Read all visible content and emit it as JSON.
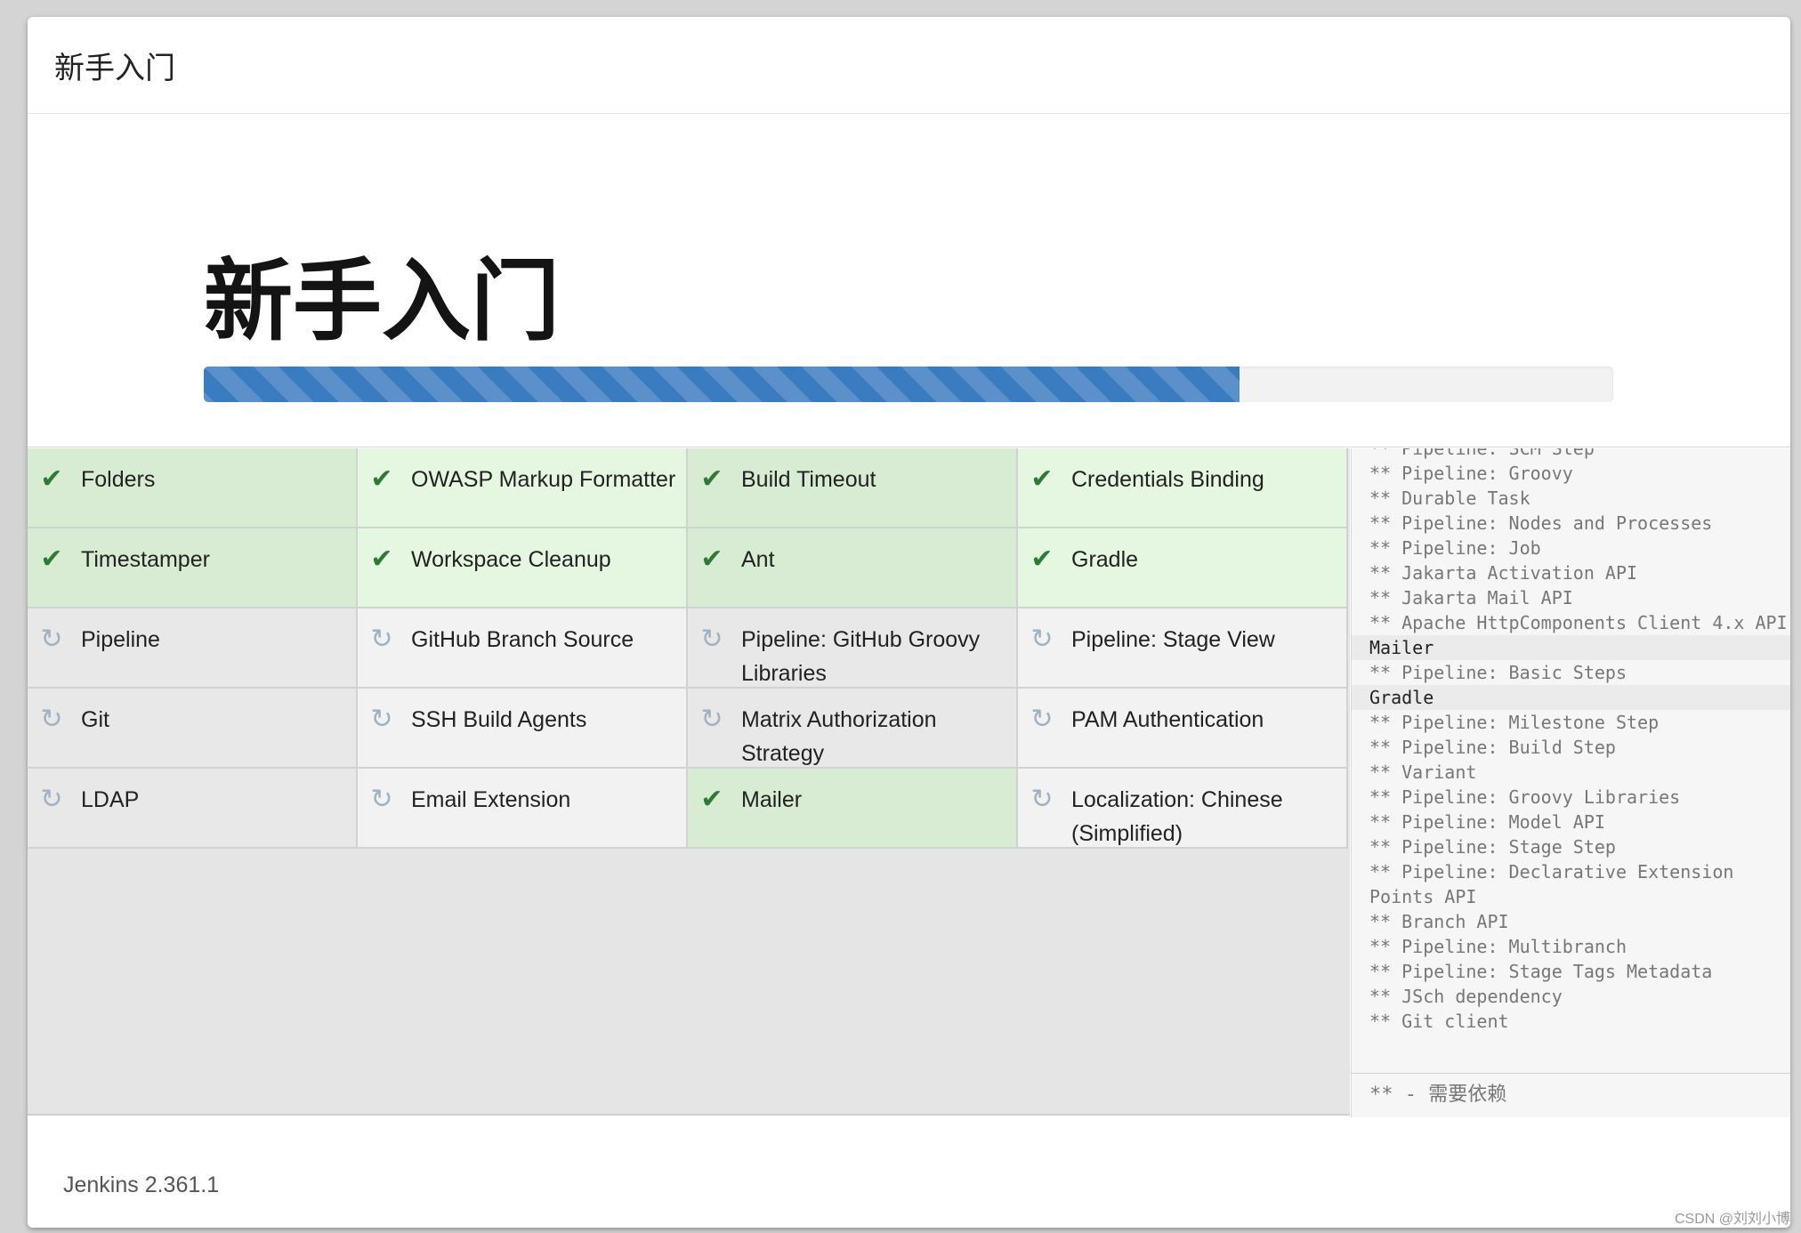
{
  "header": {
    "title": "新手入门"
  },
  "hero": {
    "title": "新手入门",
    "progress": 0.735
  },
  "plugins": [
    {
      "label": "Folders",
      "status": "success",
      "shade": "dark"
    },
    {
      "label": "OWASP Markup Formatter",
      "status": "success",
      "shade": "light"
    },
    {
      "label": "Build Timeout",
      "status": "success",
      "shade": "dark"
    },
    {
      "label": "Credentials Binding",
      "status": "success",
      "shade": "light"
    },
    {
      "label": "Timestamper",
      "status": "success",
      "shade": "dark"
    },
    {
      "label": "Workspace Cleanup",
      "status": "success",
      "shade": "light"
    },
    {
      "label": "Ant",
      "status": "success",
      "shade": "dark"
    },
    {
      "label": "Gradle",
      "status": "success",
      "shade": "light"
    },
    {
      "label": "Pipeline",
      "status": "pending",
      "shade": "dark"
    },
    {
      "label": "GitHub Branch Source",
      "status": "pending",
      "shade": "light"
    },
    {
      "label": "Pipeline: GitHub Groovy Libraries",
      "status": "pending",
      "shade": "dark"
    },
    {
      "label": "Pipeline: Stage View",
      "status": "pending",
      "shade": "light"
    },
    {
      "label": "Git",
      "status": "pending",
      "shade": "dark"
    },
    {
      "label": "SSH Build Agents",
      "status": "pending",
      "shade": "light"
    },
    {
      "label": "Matrix Authorization Strategy",
      "status": "pending",
      "shade": "dark"
    },
    {
      "label": "PAM Authentication",
      "status": "pending",
      "shade": "light"
    },
    {
      "label": "LDAP",
      "status": "pending",
      "shade": "dark"
    },
    {
      "label": "Email Extension",
      "status": "pending",
      "shade": "light"
    },
    {
      "label": "Mailer",
      "status": "success",
      "shade": "dark"
    },
    {
      "label": "Localization: Chinese (Simplified)",
      "status": "pending",
      "shade": "light"
    }
  ],
  "log": [
    {
      "text": "** Pipeline: SCM Step",
      "type": "dep"
    },
    {
      "text": "** Pipeline: Groovy",
      "type": "dep"
    },
    {
      "text": "** Durable Task",
      "type": "dep"
    },
    {
      "text": "** Pipeline: Nodes and Processes",
      "type": "dep"
    },
    {
      "text": "** Pipeline: Job",
      "type": "dep"
    },
    {
      "text": "** Jakarta Activation API",
      "type": "dep"
    },
    {
      "text": "** Jakarta Mail API",
      "type": "dep"
    },
    {
      "text": "** Apache HttpComponents Client 4.x API",
      "type": "dep"
    },
    {
      "text": "Mailer",
      "type": "plugin"
    },
    {
      "text": "** Pipeline: Basic Steps",
      "type": "dep"
    },
    {
      "text": "Gradle",
      "type": "plugin"
    },
    {
      "text": "** Pipeline: Milestone Step",
      "type": "dep"
    },
    {
      "text": "** Pipeline: Build Step",
      "type": "dep"
    },
    {
      "text": "** Variant",
      "type": "dep"
    },
    {
      "text": "** Pipeline: Groovy Libraries",
      "type": "dep"
    },
    {
      "text": "** Pipeline: Model API",
      "type": "dep"
    },
    {
      "text": "** Pipeline: Stage Step",
      "type": "dep"
    },
    {
      "text": "** Pipeline: Declarative Extension Points API",
      "type": "dep"
    },
    {
      "text": "** Branch API",
      "type": "dep"
    },
    {
      "text": "** Pipeline: Multibranch",
      "type": "dep"
    },
    {
      "text": "** Pipeline: Stage Tags Metadata",
      "type": "dep"
    },
    {
      "text": "** JSch dependency",
      "type": "dep"
    },
    {
      "text": "** Git client",
      "type": "dep"
    }
  ],
  "legend": "** - 需要依赖",
  "footer": {
    "version": "Jenkins 2.361.1"
  },
  "watermark": "CSDN @刘刘小博",
  "icons": {
    "success": "check-icon",
    "pending": "refresh-icon"
  },
  "colors": {
    "accent": "#3b7bc0",
    "success": "#2f7a35",
    "success_bg": "#d8ecd4",
    "pending_icon": "#9fb1c2"
  }
}
